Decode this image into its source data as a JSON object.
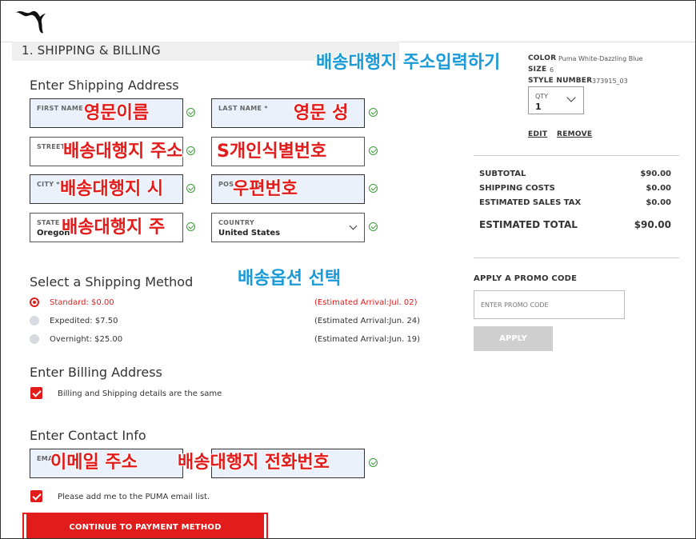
{
  "section": {
    "title": "1. SHIPPING & BILLING"
  },
  "shipping_address": {
    "heading": "Enter Shipping Address",
    "first_name_label": "FIRST NAME *",
    "last_name_label": "LAST NAME *",
    "street_label": "STREET",
    "city_label": "CITY *",
    "postal_label": "POS",
    "state_label": "STATE",
    "state_value": "Oregon",
    "country_label": "COUNTRY",
    "country_value": "United States"
  },
  "annotations": {
    "address_input": "배송대행지 주소입력하기",
    "first_name": "영문이름",
    "last_name": "영문 성",
    "street": "배송대행지 주소",
    "street_second": "S개인식별번호",
    "city": "배송대행지 시",
    "postal": "우편번호",
    "state": "배송대행지 주",
    "shipping_option": "배송옵션 선택",
    "email": "이메일 주소",
    "phone": "배송대행지 전화번호"
  },
  "shipping_method": {
    "heading": "Select a Shipping Method",
    "options": [
      {
        "label": "Standard: $0.00",
        "arrival": "(Estimated Arrival:Jul. 02)",
        "selected": true
      },
      {
        "label": "Expedited: $7.50",
        "arrival": "(Estimated Arrival:Jun. 24)",
        "selected": false
      },
      {
        "label": "Overnight: $25.00",
        "arrival": "(Estimated Arrival:Jun. 19)",
        "selected": false
      }
    ]
  },
  "billing": {
    "heading": "Enter Billing Address",
    "same_label": "Billing and Shipping details are the same"
  },
  "contact": {
    "heading": "Enter Contact Info",
    "email_label": "EMA",
    "email_list_label": "Please add me to the PUMA email list."
  },
  "continue_label": "CONTINUE TO PAYMENT METHOD",
  "product": {
    "color_key": "COLOR",
    "color_value": "Puma White-Dazzling Blue",
    "size_key": "SIZE",
    "size_value": "6",
    "style_key": "STYLE NUMBER",
    "style_value": "373915_03",
    "qty_label": "QTY",
    "qty_value": "1",
    "edit_label": "EDIT",
    "remove_label": "REMOVE"
  },
  "summary": {
    "subtotal_label": "SUBTOTAL",
    "subtotal": "$90.00",
    "shipping_label": "SHIPPING COSTS",
    "shipping": "$0.00",
    "tax_label": "ESTIMATED SALES TAX",
    "tax": "$0.00",
    "total_label": "ESTIMATED TOTAL",
    "total": "$90.00"
  },
  "promo": {
    "heading": "APPLY A PROMO CODE",
    "placeholder": "ENTER PROMO CODE",
    "apply_label": "APPLY"
  },
  "colors": {
    "accent": "#e21b1b",
    "annotation_blue": "#1a9ad6",
    "valid_green": "#3a9d3a"
  }
}
